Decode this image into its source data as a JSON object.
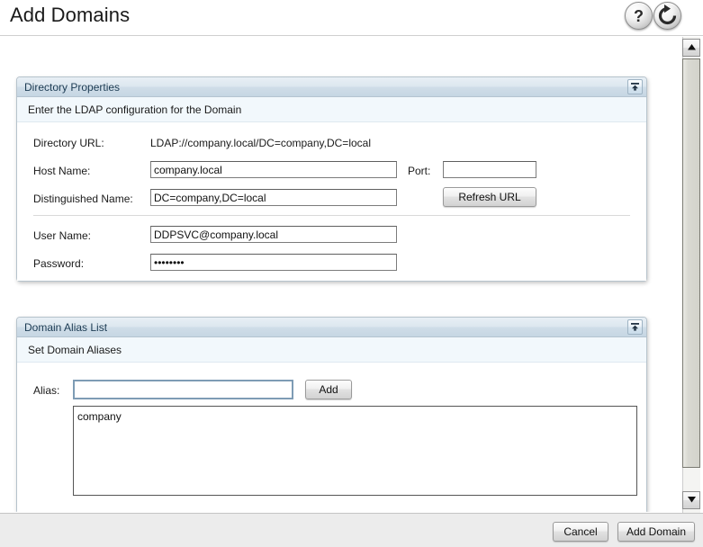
{
  "header": {
    "title": "Add Domains",
    "help_icon": "question-mark-icon",
    "refresh_icon": "refresh-icon"
  },
  "directory_properties": {
    "panel_title": "Directory Properties",
    "subtitle": "Enter the LDAP configuration for the Domain",
    "collapse_icon": "collapse-up-icon",
    "fields": {
      "directory_url_label": "Directory URL:",
      "directory_url_value": "LDAP://company.local/DC=company,DC=local",
      "host_name_label": "Host Name:",
      "host_name_value": "company.local",
      "port_label": "Port:",
      "port_value": "",
      "distinguished_name_label": "Distinguished Name:",
      "distinguished_name_value": "DC=company,DC=local",
      "refresh_url_label": "Refresh URL",
      "user_name_label": "User Name:",
      "user_name_value": "DDPSVC@company.local",
      "password_label": "Password:",
      "password_value": "ssssssss"
    }
  },
  "domain_alias_list": {
    "panel_title": "Domain Alias List",
    "subtitle": "Set Domain Aliases",
    "collapse_icon": "collapse-up-icon",
    "alias_label": "Alias:",
    "alias_value": "",
    "add_label": "Add",
    "aliases": [
      "company"
    ]
  },
  "footer": {
    "cancel_label": "Cancel",
    "add_domain_label": "Add Domain"
  },
  "scrollbar": {
    "up_icon": "triangle-up-icon",
    "down_icon": "triangle-down-icon"
  },
  "colors": {
    "panel_border": "#b6c3cc",
    "panel_header_start": "#e8eff5",
    "panel_header_end": "#c6d6e3",
    "subhead_bg": "#f2f8fc",
    "footer_bg": "#ececec",
    "focus_border": "#7e9cb5"
  }
}
